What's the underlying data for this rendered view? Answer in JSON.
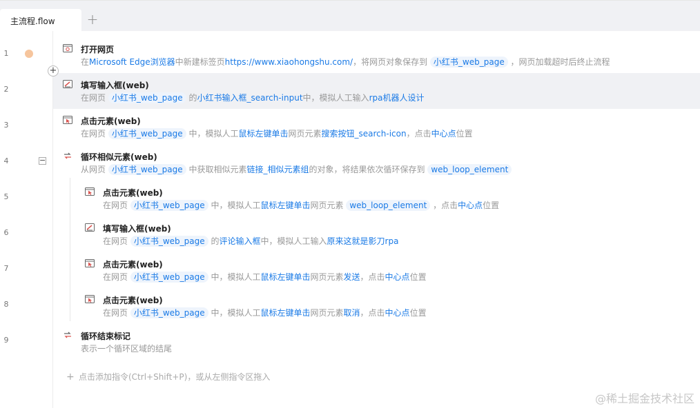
{
  "tabs": [
    {
      "label": "主流程.flow"
    }
  ],
  "new_tab_label": "+",
  "gutter": {
    "line_numbers": [
      "1",
      "2",
      "3",
      "4",
      "5",
      "6",
      "7",
      "8",
      "9"
    ],
    "insert_symbol": "+",
    "collapse_symbol": "−"
  },
  "steps": [
    {
      "title": "打开网页",
      "icon": "open-webpage-icon",
      "desc": [
        "在",
        "Microsoft Edge浏览器",
        "中新建标签页",
        "https://www.xiaohongshu.com/",
        "，将网页对象保存到",
        "小红书_web_page",
        "，网页加载超时后终止流程"
      ]
    },
    {
      "title": "填写输入框(web)",
      "icon": "fill-input-icon",
      "desc": [
        "在网页",
        "小红书_web_page",
        "的",
        "小红书输入框_search-input",
        "中，模拟人工输入",
        "rpa机器人设计"
      ]
    },
    {
      "title": "点击元素(web)",
      "icon": "click-element-icon",
      "desc": [
        "在网页",
        "小红书_web_page",
        "中，模拟人工",
        "鼠标左键单击",
        "网页元素",
        "搜索按钮_search-icon",
        "，点击",
        "中心点",
        "位置"
      ]
    },
    {
      "title": "循环相似元素(web)",
      "icon": "loop-elements-icon",
      "desc": [
        "从网页",
        "小红书_web_page",
        "中获取相似元素",
        "链接_相似元素组",
        "的对象，将结果依次循环保存到",
        "web_loop_element"
      ]
    },
    {
      "title": "点击元素(web)",
      "icon": "click-element-icon",
      "desc": [
        "在网页",
        "小红书_web_page",
        "中，模拟人工",
        "鼠标左键单击",
        "网页元素",
        "web_loop_element",
        "，点击",
        "中心点",
        "位置"
      ]
    },
    {
      "title": "填写输入框(web)",
      "icon": "fill-input-icon",
      "desc": [
        "在网页",
        "小红书_web_page",
        "的",
        "评论输入框",
        "中，模拟人工输入",
        "原来这就是影刀rpa"
      ]
    },
    {
      "title": "点击元素(web)",
      "icon": "click-element-icon",
      "desc": [
        "在网页",
        "小红书_web_page",
        "中，模拟人工",
        "鼠标左键单击",
        "网页元素",
        "发送",
        "，点击",
        "中心点",
        "位置"
      ]
    },
    {
      "title": "点击元素(web)",
      "icon": "click-element-icon",
      "desc": [
        "在网页",
        "小红书_web_page",
        "中，模拟人工",
        "鼠标左键单击",
        "网页元素",
        "取消",
        "，点击",
        "中心点",
        "位置"
      ]
    },
    {
      "title": "循环结束标记",
      "icon": "loop-end-icon",
      "desc": [
        "表示一个循环区域的结尾"
      ]
    }
  ],
  "add_hint": {
    "plus": "+",
    "text": "点击添加指令(Ctrl+Shift+P)，或从左侧指令区拖入"
  },
  "watermark": "@稀土掘金技术社区",
  "colors": {
    "link": "#1a7ae6",
    "chip_bg": "#eef4fc",
    "breakpoint": "#f6c59d",
    "icon_red": "#d9534f",
    "selected_row": "#f0f1f4"
  }
}
